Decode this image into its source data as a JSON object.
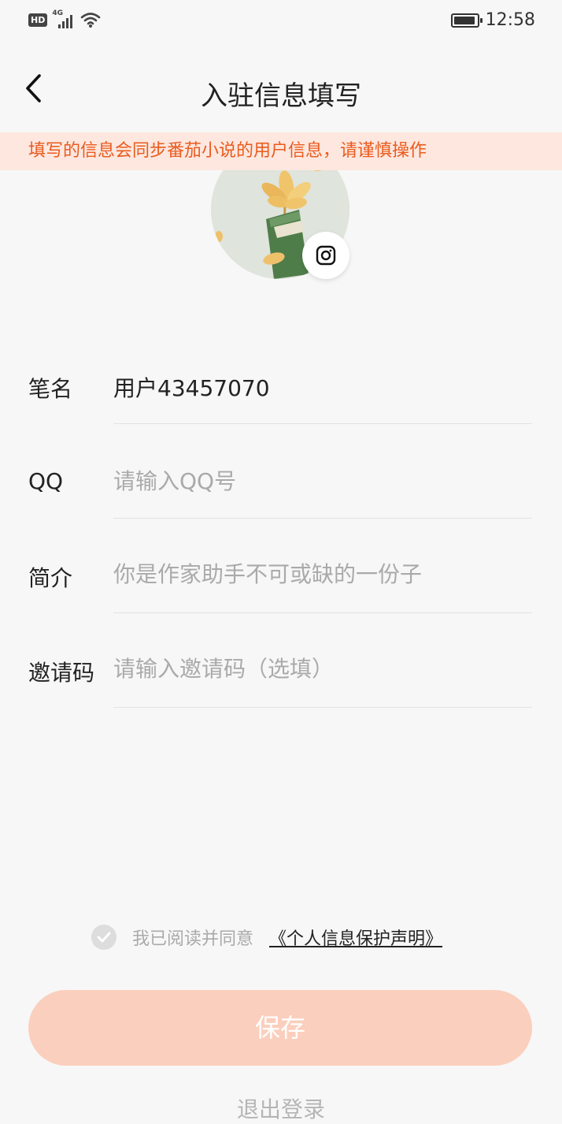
{
  "status_bar": {
    "hd": "HD",
    "network": "4G",
    "time": "12:58"
  },
  "header": {
    "title": "入驻信息填写"
  },
  "notice": {
    "text": "填写的信息会同步番茄小说的用户信息，请谨慎操作"
  },
  "form": {
    "pen_name": {
      "label": "笔名",
      "value": "用户43457070",
      "placeholder": ""
    },
    "qq": {
      "label": "QQ",
      "value": "",
      "placeholder": "请输入QQ号"
    },
    "intro": {
      "label": "简介",
      "value": "",
      "placeholder": "你是作家助手不可或缺的一份子"
    },
    "invite_code": {
      "label": "邀请码",
      "value": "",
      "placeholder": "请输入邀请码（选填）"
    }
  },
  "agreement": {
    "text": "我已阅读并同意",
    "link": "《个人信息保护声明》"
  },
  "buttons": {
    "save": "保存",
    "logout": "退出登录"
  },
  "colors": {
    "accent": "#ea5b1e",
    "notice_bg": "#fde7df",
    "save_bg": "#fbcfbd"
  }
}
